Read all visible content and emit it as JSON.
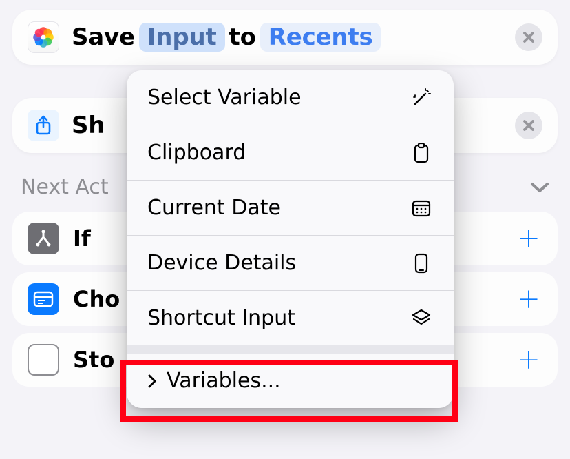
{
  "card1": {
    "prefix": "Save",
    "token_input": "Input",
    "mid": "to",
    "token_recents": "Recents"
  },
  "card2": {
    "label": "Sh"
  },
  "section": {
    "title": "Next Act"
  },
  "suggestions": {
    "if": "If",
    "cho": "Cho",
    "stop": "Sto"
  },
  "popup": {
    "select_variable": "Select Variable",
    "clipboard": "Clipboard",
    "current_date": "Current Date",
    "device_details": "Device Details",
    "shortcut_input": "Shortcut Input",
    "variables": "Variables..."
  }
}
